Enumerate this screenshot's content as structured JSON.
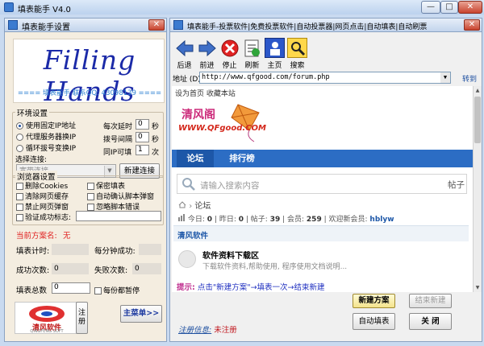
{
  "window": {
    "title": "填表能手 V4.0",
    "min_label": "—",
    "max_label": "□",
    "close_label": "✕"
  },
  "settings": {
    "title": "填表能手设置",
    "close_label": "✕",
    "logo": {
      "text": "Filling Hands",
      "subtitle": "==== 填表能手  联系QQ: 43098139 ===="
    },
    "env": {
      "title": "环境设置",
      "options": [
        "使用固定IP地址",
        "代理服务器换IP",
        "循环拔号变换IP"
      ],
      "selected_index": 0,
      "params": [
        {
          "label": "每次延时",
          "value": "0",
          "unit": "秒"
        },
        {
          "label": "拨号间隔",
          "value": "0",
          "unit": "秒"
        },
        {
          "label": "同IP可填",
          "value": "1",
          "unit": "次"
        }
      ],
      "connect_label": "选择连接:",
      "connect_value": "宽带连接",
      "new_connect_button": "新建连接"
    },
    "browser": {
      "title": "浏览器设置",
      "options": [
        "删除Cookies",
        "保密填表",
        "清除网页缓存",
        "自动确认脚本弹窗",
        "禁止网页弹窗",
        "忽略脚本错误",
        "验证成功标志:"
      ],
      "verify_value": ""
    },
    "scheme": {
      "label": "当前方案名:",
      "value": "无"
    },
    "stats": {
      "fill_time_label": "填表计时:",
      "fill_time_value": "",
      "per_min_label": "每分钟成功:",
      "per_min_value": "",
      "success_label": "成功次数:",
      "success_value": "0",
      "fail_label": "失败次数:",
      "fail_value": "0",
      "total_label": "填表总数",
      "total_value": "0",
      "pause_label": "每份都暂停"
    },
    "brand": {
      "text": "清风软件",
      "sub": "QINGFENG SOFT"
    },
    "menu_short_label": "注册",
    "main_menu_button": "主菜单>>"
  },
  "browser_window": {
    "title": "填表能手-投票软件|免费投票软件|自动投票器|网页点击|自动填表|自动刷票 - Powe...",
    "close_label": "✕",
    "toolbar": [
      {
        "label": "后退",
        "icon": "back-arrow-icon"
      },
      {
        "label": "前进",
        "icon": "forward-arrow-icon"
      },
      {
        "label": "停止",
        "icon": "stop-icon"
      },
      {
        "label": "刷新",
        "icon": "refresh-icon"
      },
      {
        "label": "主页",
        "icon": "home-icon"
      },
      {
        "label": "搜索",
        "icon": "search-icon"
      }
    ],
    "address_label": "地址 (D)",
    "address_value": "http://www.qfgood.com/forum.php",
    "go_label": "转到",
    "page": {
      "top_links": "设为首页  收藏本站",
      "site_logo_text": "清风阁",
      "site_logo_url": "WWW.QFgood.COM",
      "nav": [
        "论坛",
        "排行榜"
      ],
      "search_placeholder": "请输入搜索内容",
      "search_right": "帖子",
      "breadcrumb_arrow": "›",
      "breadcrumb": "论坛",
      "stats": {
        "today_label": "今日:",
        "today_value": "0",
        "yesterday_label": "昨日:",
        "yesterday_value": "0",
        "posts_label": "帖子:",
        "posts_value": "39",
        "members_label": "会员:",
        "members_value": "259",
        "welcome_label": "欢迎新会员:",
        "newest_member": "hblyw"
      },
      "category": "清风软件",
      "forum_name": "软件资料下载区",
      "forum_desc": "下载软件资料,帮助使用, 程序使用文档说明..."
    },
    "tip_label": "提示:",
    "tip_text": "点击\"新建方案\"→填表一次→结束新建",
    "buttons": {
      "new_scheme": "新建方案",
      "end_new": "结束新建",
      "auto_fill": "自动填表",
      "close": "关  闭"
    },
    "reg_label": "注册信息:",
    "reg_value": "未注册"
  }
}
